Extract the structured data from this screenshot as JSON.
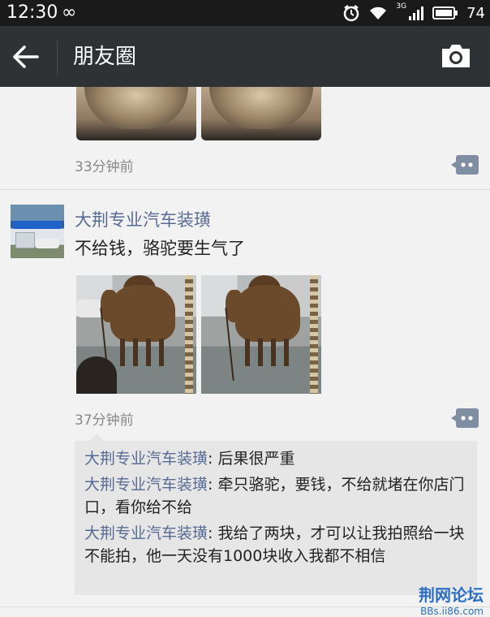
{
  "status_bar": {
    "time": "12:30",
    "link_symbol": "∞",
    "network": "3G",
    "battery_text": "74"
  },
  "title_bar": {
    "title": "朋友圈",
    "back_icon": "arrow-left-icon",
    "camera_icon": "camera-icon"
  },
  "previous_post": {
    "time": "33分钟前"
  },
  "post": {
    "author": "大荆专业汽车装璜",
    "text": "不给钱，骆驼要生气了",
    "time": "37分钟前",
    "photos": [
      "camel-photo-1",
      "camel-photo-2"
    ],
    "comments": [
      {
        "name": "大荆专业汽车装璜",
        "text": ": 后果很严重"
      },
      {
        "name": "大荆专业汽车装璜",
        "text": ": 牵只骆驼，要钱，不给就堵在你店门口，看你给不给"
      },
      {
        "name": "大荆专业汽车装璜",
        "text": ": 我给了两块，才可以让我拍照给一块不能拍，他一天没有1000块收入我都不相信"
      }
    ]
  },
  "watermark": {
    "line1": "荆网论坛",
    "line2": "BBs.ii86.com"
  },
  "colors": {
    "title_bar": "#2f3235",
    "name_link": "#586b94",
    "watermark": "#2d6fc4"
  }
}
